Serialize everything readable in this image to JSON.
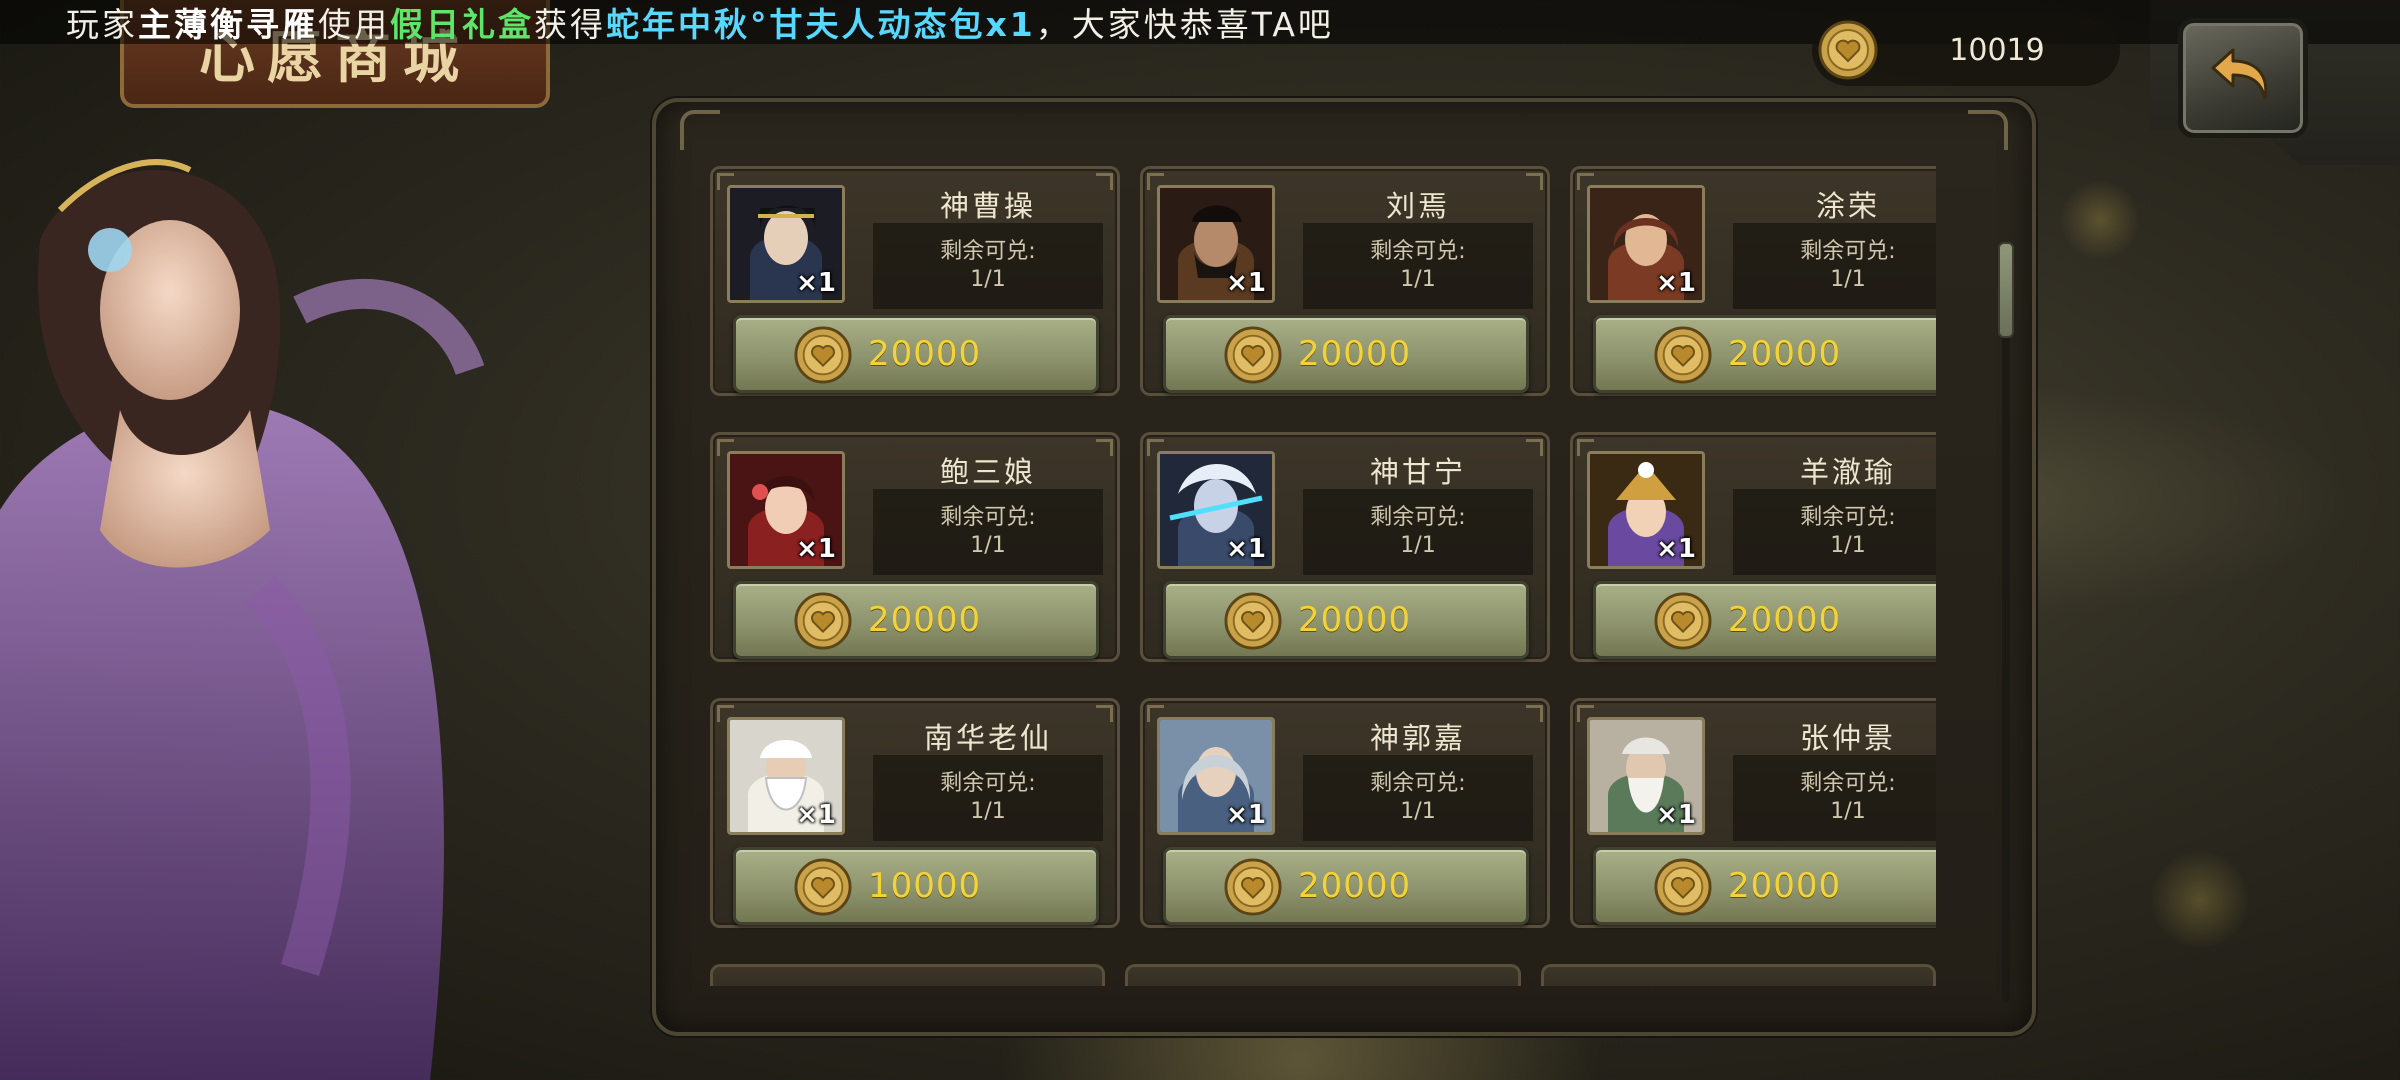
{
  "broadcast": {
    "prefix": "玩家",
    "player": "主薄衡寻雁",
    "verb": "使用",
    "item_used": "假日礼盒",
    "obtained": "获得",
    "reward": "蛇年中秋°甘夫人动态包x1",
    "suffix": "，大家快恭喜TA吧"
  },
  "shop": {
    "title": "心愿商城"
  },
  "currency": {
    "icon": "heart-coin-icon",
    "amount": "10019"
  },
  "colors": {
    "price_text": "#f4d23a",
    "broadcast_green": "#5fe56a",
    "broadcast_cyan": "#58d8ff",
    "button_green": "#8d936d"
  },
  "items": [
    {
      "name": "神曹操",
      "qty": "×1",
      "stock_label": "剩余可兑:",
      "stock": "1/1",
      "price": "20000"
    },
    {
      "name": "刘焉",
      "qty": "×1",
      "stock_label": "剩余可兑:",
      "stock": "1/1",
      "price": "20000"
    },
    {
      "name": "涂荣",
      "qty": "×1",
      "stock_label": "剩余可兑:",
      "stock": "1/1",
      "price": "20000"
    },
    {
      "name": "鲍三娘",
      "qty": "×1",
      "stock_label": "剩余可兑:",
      "stock": "1/1",
      "price": "20000"
    },
    {
      "name": "神甘宁",
      "qty": "×1",
      "stock_label": "剩余可兑:",
      "stock": "1/1",
      "price": "20000"
    },
    {
      "name": "羊澈瑜",
      "qty": "×1",
      "stock_label": "剩余可兑:",
      "stock": "1/1",
      "price": "20000"
    },
    {
      "name": "南华老仙",
      "qty": "×1",
      "stock_label": "剩余可兑:",
      "stock": "1/1",
      "price": "10000"
    },
    {
      "name": "神郭嘉",
      "qty": "×1",
      "stock_label": "剩余可兑:",
      "stock": "1/1",
      "price": "20000"
    },
    {
      "name": "张仲景",
      "qty": "×1",
      "stock_label": "剩余可兑:",
      "stock": "1/1",
      "price": "20000"
    }
  ]
}
